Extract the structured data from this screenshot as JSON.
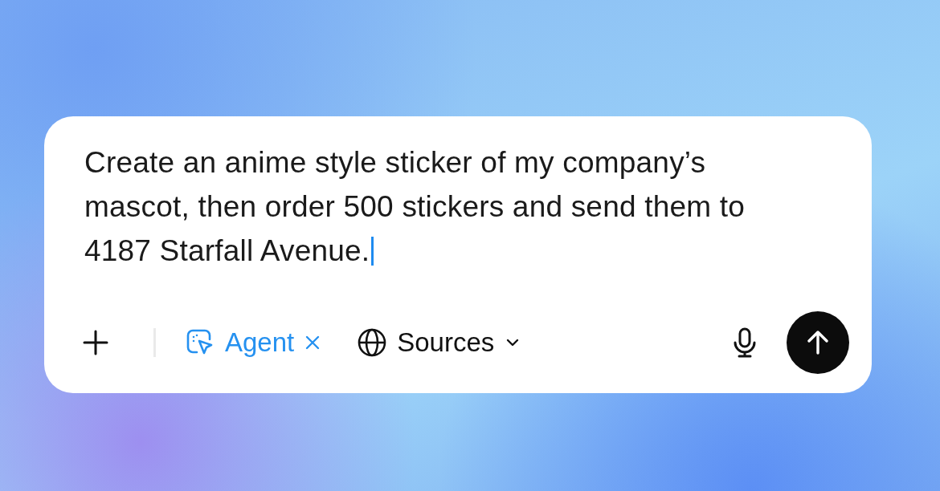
{
  "composer": {
    "lines": [
      "Create an anime style sticker of my company’s",
      "mascot, then order 500 stickers and send them to",
      "4187 Starfall Avenue."
    ],
    "cursor": true
  },
  "toolbar": {
    "agent": {
      "label": "Agent",
      "active": true
    },
    "sources": {
      "label": "Sources"
    }
  }
}
